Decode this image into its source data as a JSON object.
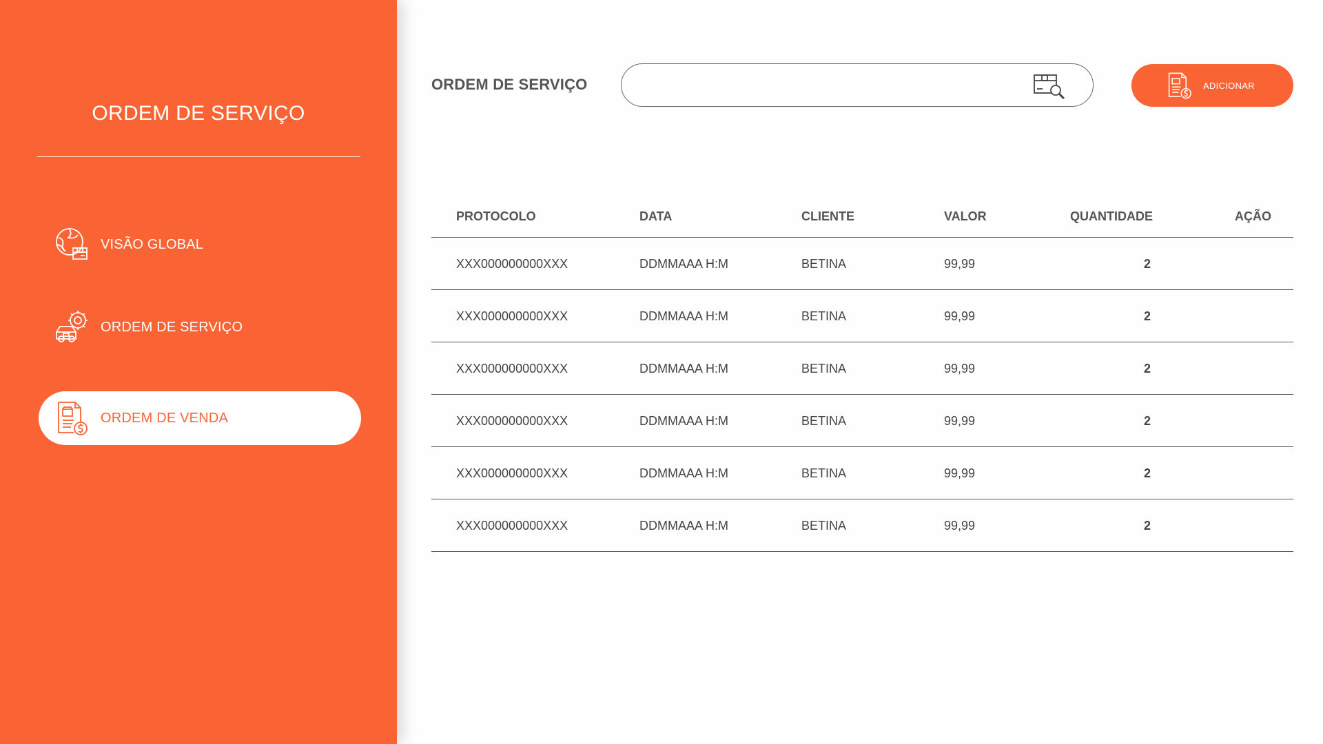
{
  "sidebar": {
    "title": "ORDEM DE SERVIÇO",
    "items": [
      {
        "label": "VISÃO GLOBAL",
        "icon": "globe-package-icon",
        "active": false
      },
      {
        "label": "ORDEM DE SERVIÇO",
        "icon": "car-gear-icon",
        "active": false
      },
      {
        "label": "ORDEM DE VENDA",
        "icon": "invoice-dollar-icon",
        "active": true
      }
    ]
  },
  "header": {
    "title": "ORDEM DE SERVIÇO",
    "search": {
      "value": "",
      "placeholder": "",
      "icon": "package-search-icon"
    },
    "add_button": {
      "label": "ADICIONAR",
      "icon": "invoice-dollar-icon"
    }
  },
  "table": {
    "columns": [
      "PROTOCOLO",
      "DATA",
      "CLIENTE",
      "VALOR",
      "QUANTIDADE",
      "AÇÃO"
    ],
    "rows": [
      {
        "protocolo": "XXX000000000XXX",
        "data": "DDMMAAA H:M",
        "cliente": "BETINA",
        "valor": "99,99",
        "quantidade": "2"
      },
      {
        "protocolo": "XXX000000000XXX",
        "data": "DDMMAAA H:M",
        "cliente": "BETINA",
        "valor": "99,99",
        "quantidade": "2"
      },
      {
        "protocolo": "XXX000000000XXX",
        "data": "DDMMAAA H:M",
        "cliente": "BETINA",
        "valor": "99,99",
        "quantidade": "2"
      },
      {
        "protocolo": "XXX000000000XXX",
        "data": "DDMMAAA H:M",
        "cliente": "BETINA",
        "valor": "99,99",
        "quantidade": "2"
      },
      {
        "protocolo": "XXX000000000XXX",
        "data": "DDMMAAA H:M",
        "cliente": "BETINA",
        "valor": "99,99",
        "quantidade": "2"
      },
      {
        "protocolo": "XXX000000000XXX",
        "data": "DDMMAAA H:M",
        "cliente": "BETINA",
        "valor": "99,99",
        "quantidade": "2"
      }
    ]
  },
  "colors": {
    "accent": "#fa6434",
    "text": "#555555",
    "background": "#ffffff"
  }
}
